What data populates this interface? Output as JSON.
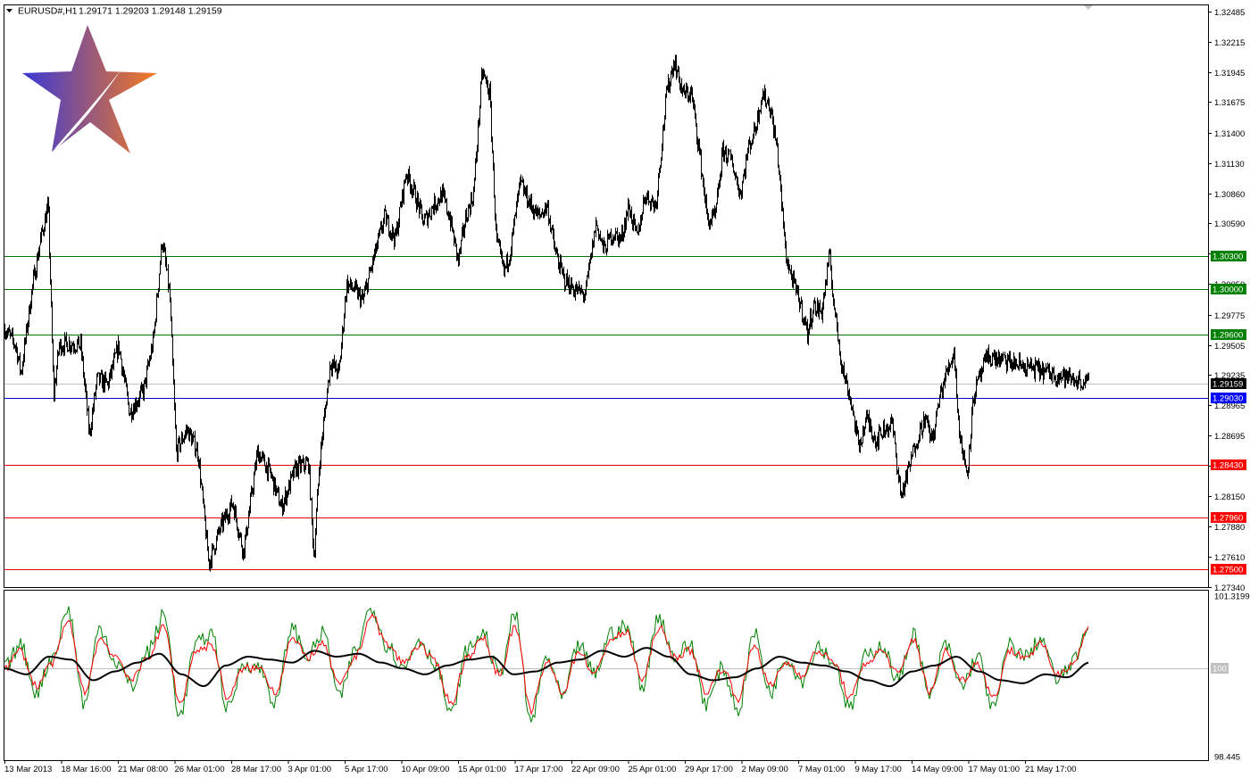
{
  "header": {
    "symbol_label": "EURUSD#,H1",
    "ohlc": "1.29171 1.29203 1.29148 1.29159"
  },
  "colors": {
    "background": "#ffffff",
    "candles": "#000000",
    "resistance_line": "#007000",
    "resistance_badge": "#008000",
    "support_line": "#e00000",
    "support_badge": "#ff0000",
    "pivot_line": "#0000d0",
    "pivot_badge": "#0000ff",
    "current_price_badge": "#000000",
    "osc_fast": "#008000",
    "osc_slow": "#ff0000",
    "osc_signal": "#000000",
    "logo_left": "#3a38d8",
    "logo_right": "#f57a20"
  },
  "chart_data": [
    {
      "type": "candlestick",
      "name": "EURUSD#,H1",
      "ylim": [
        1.2734,
        1.3254
      ],
      "y_ticks": [
        "1.32485",
        "1.32215",
        "1.31945",
        "1.31675",
        "1.31400",
        "1.31130",
        "1.30860",
        "1.30590",
        "1.30320",
        "1.30050",
        "1.29775",
        "1.29505",
        "1.29235",
        "1.28965",
        "1.28695",
        "1.28425",
        "1.28150",
        "1.27880",
        "1.27610",
        "1.27340"
      ],
      "x_ticks": [
        "13 Mar 2013",
        "18 Mar 16:00",
        "21 Mar 08:00",
        "26 Mar 01:00",
        "28 Mar 17:00",
        "3 Apr 01:00",
        "5 Apr 17:00",
        "10 Apr 09:00",
        "15 Apr 01:00",
        "17 Apr 17:00",
        "22 Apr 09:00",
        "25 Apr 01:00",
        "29 Apr 17:00",
        "2 May 09:00",
        "7 May 01:00",
        "9 May 17:00",
        "14 May 09:00",
        "17 May 01:00",
        "21 May 17:00"
      ],
      "current_price": 1.29159,
      "levels": [
        {
          "price": 1.303,
          "label": "1.30300",
          "kind": "resistance"
        },
        {
          "price": 1.3,
          "label": "1.30000",
          "kind": "resistance"
        },
        {
          "price": 1.296,
          "label": "1.29600",
          "kind": "resistance"
        },
        {
          "price": 1.2903,
          "label": "1.29030",
          "kind": "pivot"
        },
        {
          "price": 1.2843,
          "label": "1.28430",
          "kind": "support"
        },
        {
          "price": 1.2796,
          "label": "1.27960",
          "kind": "support"
        },
        {
          "price": 1.275,
          "label": "1.27500",
          "kind": "support"
        }
      ],
      "close_path": [
        [
          0,
          1.2965
        ],
        [
          0.01,
          1.295
        ],
        [
          0.015,
          1.2925
        ],
        [
          0.025,
          1.3
        ],
        [
          0.033,
          1.3045
        ],
        [
          0.04,
          1.3075
        ],
        [
          0.045,
          1.2905
        ],
        [
          0.05,
          1.295
        ],
        [
          0.06,
          1.2952
        ],
        [
          0.07,
          1.295
        ],
        [
          0.078,
          1.287
        ],
        [
          0.085,
          1.292
        ],
        [
          0.095,
          1.2915
        ],
        [
          0.105,
          1.295
        ],
        [
          0.115,
          1.289
        ],
        [
          0.128,
          1.291
        ],
        [
          0.137,
          1.2955
        ],
        [
          0.145,
          1.3045
        ],
        [
          0.152,
          1.2995
        ],
        [
          0.158,
          1.2855
        ],
        [
          0.168,
          1.2875
        ],
        [
          0.178,
          1.2855
        ],
        [
          0.188,
          1.2755
        ],
        [
          0.198,
          1.2785
        ],
        [
          0.21,
          1.281
        ],
        [
          0.22,
          1.2765
        ],
        [
          0.233,
          1.2855
        ],
        [
          0.245,
          1.2835
        ],
        [
          0.255,
          1.2805
        ],
        [
          0.268,
          1.284
        ],
        [
          0.28,
          1.2845
        ],
        [
          0.285,
          1.276
        ],
        [
          0.29,
          1.2845
        ],
        [
          0.3,
          1.2935
        ],
        [
          0.308,
          1.2925
        ],
        [
          0.315,
          1.3005
        ],
        [
          0.322,
          1.3
        ],
        [
          0.33,
          1.299
        ],
        [
          0.338,
          1.302
        ],
        [
          0.35,
          1.3065
        ],
        [
          0.36,
          1.3045
        ],
        [
          0.37,
          1.3105
        ],
        [
          0.378,
          1.3085
        ],
        [
          0.386,
          1.306
        ],
        [
          0.395,
          1.3075
        ],
        [
          0.403,
          1.3085
        ],
        [
          0.41,
          1.3065
        ],
        [
          0.418,
          1.3025
        ],
        [
          0.425,
          1.3065
        ],
        [
          0.432,
          1.3085
        ],
        [
          0.44,
          1.3195
        ],
        [
          0.447,
          1.3175
        ],
        [
          0.453,
          1.3045
        ],
        [
          0.46,
          1.3015
        ],
        [
          0.466,
          1.3035
        ],
        [
          0.475,
          1.3095
        ],
        [
          0.485,
          1.3075
        ],
        [
          0.492,
          1.3065
        ],
        [
          0.5,
          1.3075
        ],
        [
          0.507,
          1.3035
        ],
        [
          0.515,
          1.301
        ],
        [
          0.525,
          1.3
        ],
        [
          0.535,
          1.2995
        ],
        [
          0.545,
          1.306
        ],
        [
          0.552,
          1.3035
        ],
        [
          0.56,
          1.305
        ],
        [
          0.568,
          1.3045
        ],
        [
          0.575,
          1.3075
        ],
        [
          0.583,
          1.3045
        ],
        [
          0.59,
          1.3085
        ],
        [
          0.6,
          1.3075
        ],
        [
          0.61,
          1.3175
        ],
        [
          0.617,
          1.3205
        ],
        [
          0.625,
          1.3175
        ],
        [
          0.633,
          1.3175
        ],
        [
          0.64,
          1.3125
        ],
        [
          0.648,
          1.306
        ],
        [
          0.655,
          1.3065
        ],
        [
          0.662,
          1.3125
        ],
        [
          0.67,
          1.3115
        ],
        [
          0.678,
          1.3085
        ],
        [
          0.685,
          1.3125
        ],
        [
          0.692,
          1.3145
        ],
        [
          0.698,
          1.3175
        ],
        [
          0.705,
          1.3165
        ],
        [
          0.712,
          1.3125
        ],
        [
          0.72,
          1.303
        ],
        [
          0.727,
          1.3005
        ],
        [
          0.734,
          1.2985
        ],
        [
          0.74,
          1.296
        ],
        [
          0.745,
          1.2985
        ],
        [
          0.753,
          1.298
        ],
        [
          0.76,
          1.303
        ],
        [
          0.765,
          1.298
        ],
        [
          0.772,
          1.293
        ],
        [
          0.78,
          1.29
        ],
        [
          0.787,
          1.286
        ],
        [
          0.795,
          1.2885
        ],
        [
          0.803,
          1.2865
        ],
        [
          0.81,
          1.2875
        ],
        [
          0.818,
          1.288
        ],
        [
          0.826,
          1.2815
        ],
        [
          0.832,
          1.2835
        ],
        [
          0.84,
          1.2865
        ],
        [
          0.848,
          1.2885
        ],
        [
          0.855,
          1.2865
        ],
        [
          0.862,
          1.2905
        ],
        [
          0.868,
          1.2925
        ],
        [
          0.875,
          1.2945
        ],
        [
          0.88,
          1.287
        ],
        [
          0.887,
          1.2835
        ],
        [
          0.893,
          1.2905
        ],
        [
          0.9,
          1.2925
        ],
        [
          0.906,
          1.294
        ],
        [
          1,
          1.2916
        ]
      ],
      "noise_amplitude": 0.0011
    },
    {
      "type": "oscillator",
      "ylim": [
        98.445,
        101.3199
      ],
      "y_ticks": [
        "101.3199",
        "100",
        "98.445"
      ],
      "series": [
        {
          "role": "fast",
          "values": [
            100,
            100.4,
            99.6,
            100.2,
            101,
            99.4,
            100.7,
            100.1,
            99.7,
            100.3,
            100.9,
            99.2,
            100.4,
            100.6,
            99.3,
            100.1,
            100,
            99.4,
            100.7,
            100.2,
            100.6,
            99.5,
            100.3,
            101.05,
            100.4,
            100,
            100.5,
            100.1,
            99.2,
            100.3,
            100.6,
            99.9,
            100.9,
            99.1,
            100.2,
            99.5,
            100.4,
            99.9,
            100.6,
            100.7,
            99.7,
            100.9,
            100.2,
            100.4,
            99.4,
            100,
            99.3,
            100.6,
            99.6,
            100.2,
            99.8,
            100.4,
            100.1,
            99.3,
            100.2,
            100.4,
            99.8,
            100.6,
            99.5,
            100.4,
            99.7,
            100.2,
            99.3,
            100.4,
            100.2,
            100.5,
            99.8,
            100.1,
            100.8
          ]
        },
        {
          "role": "slow",
          "values": [
            100,
            100.3,
            99.7,
            100.1,
            100.8,
            99.6,
            100.5,
            100.2,
            99.8,
            100.2,
            100.7,
            99.4,
            100.3,
            100.4,
            99.5,
            100,
            100,
            99.6,
            100.5,
            100.2,
            100.4,
            99.7,
            100.2,
            100.9,
            100.4,
            100.1,
            100.4,
            100.1,
            99.4,
            100.2,
            100.5,
            99.9,
            100.7,
            99.3,
            100.1,
            99.6,
            100.3,
            99.9,
            100.5,
            100.6,
            99.8,
            100.7,
            100.2,
            100.3,
            99.6,
            100,
            99.5,
            100.4,
            99.7,
            100.1,
            99.9,
            100.3,
            100.1,
            99.5,
            100.1,
            100.3,
            99.9,
            100.5,
            99.6,
            100.3,
            99.8,
            100.1,
            99.5,
            100.3,
            100.2,
            100.4,
            99.9,
            100.1,
            100.7
          ]
        },
        {
          "role": "signal",
          "values": [
            100,
            99.9,
            100.2,
            100.15,
            99.8,
            99.95,
            100.1,
            100.25,
            99.9,
            99.7,
            100.05,
            100.2,
            100.15,
            100.1,
            100.3,
            100.2,
            100.25,
            100.1,
            100.0,
            99.9,
            100.05,
            100.15,
            100.2,
            99.9,
            99.95,
            100.1,
            100.15,
            100.3,
            100.2,
            100.35,
            100.2,
            99.9,
            99.8,
            99.85,
            100.0,
            100.2,
            100.1,
            100.05,
            99.95,
            99.8,
            99.7,
            99.95,
            100.05,
            100.2,
            99.95,
            99.8,
            99.75,
            99.9,
            99.85,
            100.1
          ]
        }
      ]
    }
  ]
}
